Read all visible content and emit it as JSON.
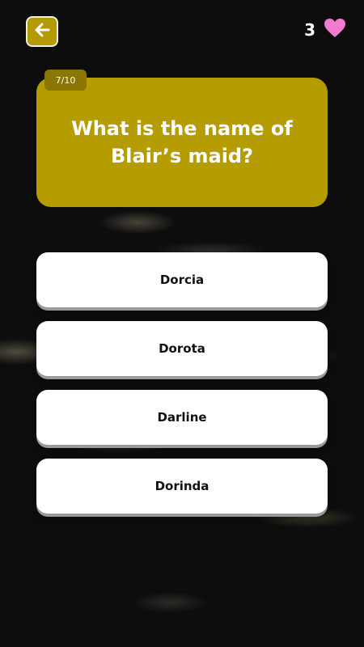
{
  "header": {
    "back_icon": "arrow-left-icon",
    "lives": "3",
    "lives_icon": "heart-icon",
    "heart_color": "#f27bd0"
  },
  "question": {
    "progress": "7/10",
    "text": "What is the name of Blair’s maid?"
  },
  "answers": [
    {
      "label": "Dorcia"
    },
    {
      "label": "Dorota"
    },
    {
      "label": "Darline"
    },
    {
      "label": "Dorinda"
    }
  ],
  "colors": {
    "accent": "#b59c00",
    "background": "#0d0d0d"
  }
}
